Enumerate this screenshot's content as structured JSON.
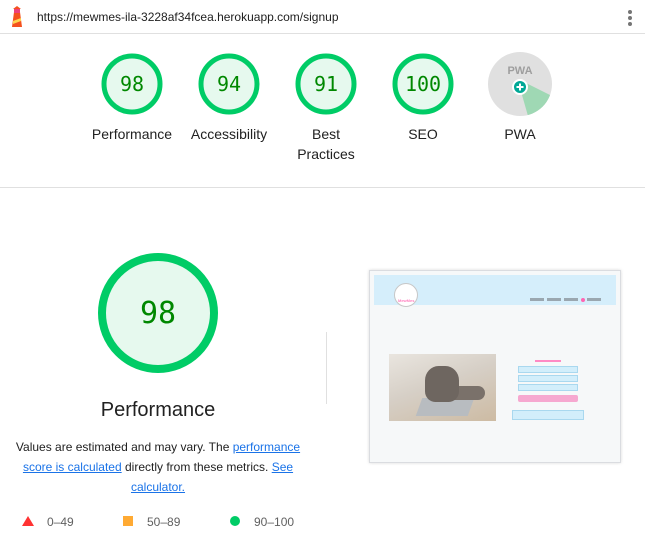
{
  "browser": {
    "url": "https://mewmes-ila-3228af34fcea.herokuapp.com/signup",
    "menu_icon": "kebab-menu-icon",
    "logo_icon": "lighthouse-icon"
  },
  "summary": {
    "categories": [
      {
        "label": "Performance",
        "score": 98
      },
      {
        "label": "Accessibility",
        "score": 94
      },
      {
        "label": "Best Practices",
        "score": 91
      },
      {
        "label": "SEO",
        "score": 100
      },
      {
        "label": "PWA",
        "score": null,
        "badge": "PWA"
      }
    ]
  },
  "performance": {
    "score": "98",
    "title": "Performance",
    "desc_part1": "Values are estimated and may vary. The ",
    "link_score": "performance score is calculated",
    "desc_part2": " directly from these metrics. ",
    "link_calc": "See calculator."
  },
  "legend": {
    "fail": "0–49",
    "average": "50–89",
    "pass": "90–100"
  },
  "thumbnail": {
    "logo_text": "MewMes"
  },
  "colors": {
    "pass": "#00cc66",
    "pass_text": "#008800",
    "pass_fill": "#e6f9ee",
    "average": "#ffaa33",
    "fail": "#ff3333",
    "link": "#1a73e8",
    "pwa_gray": "#e0e0e0",
    "pwa_badge": "#00a896"
  }
}
